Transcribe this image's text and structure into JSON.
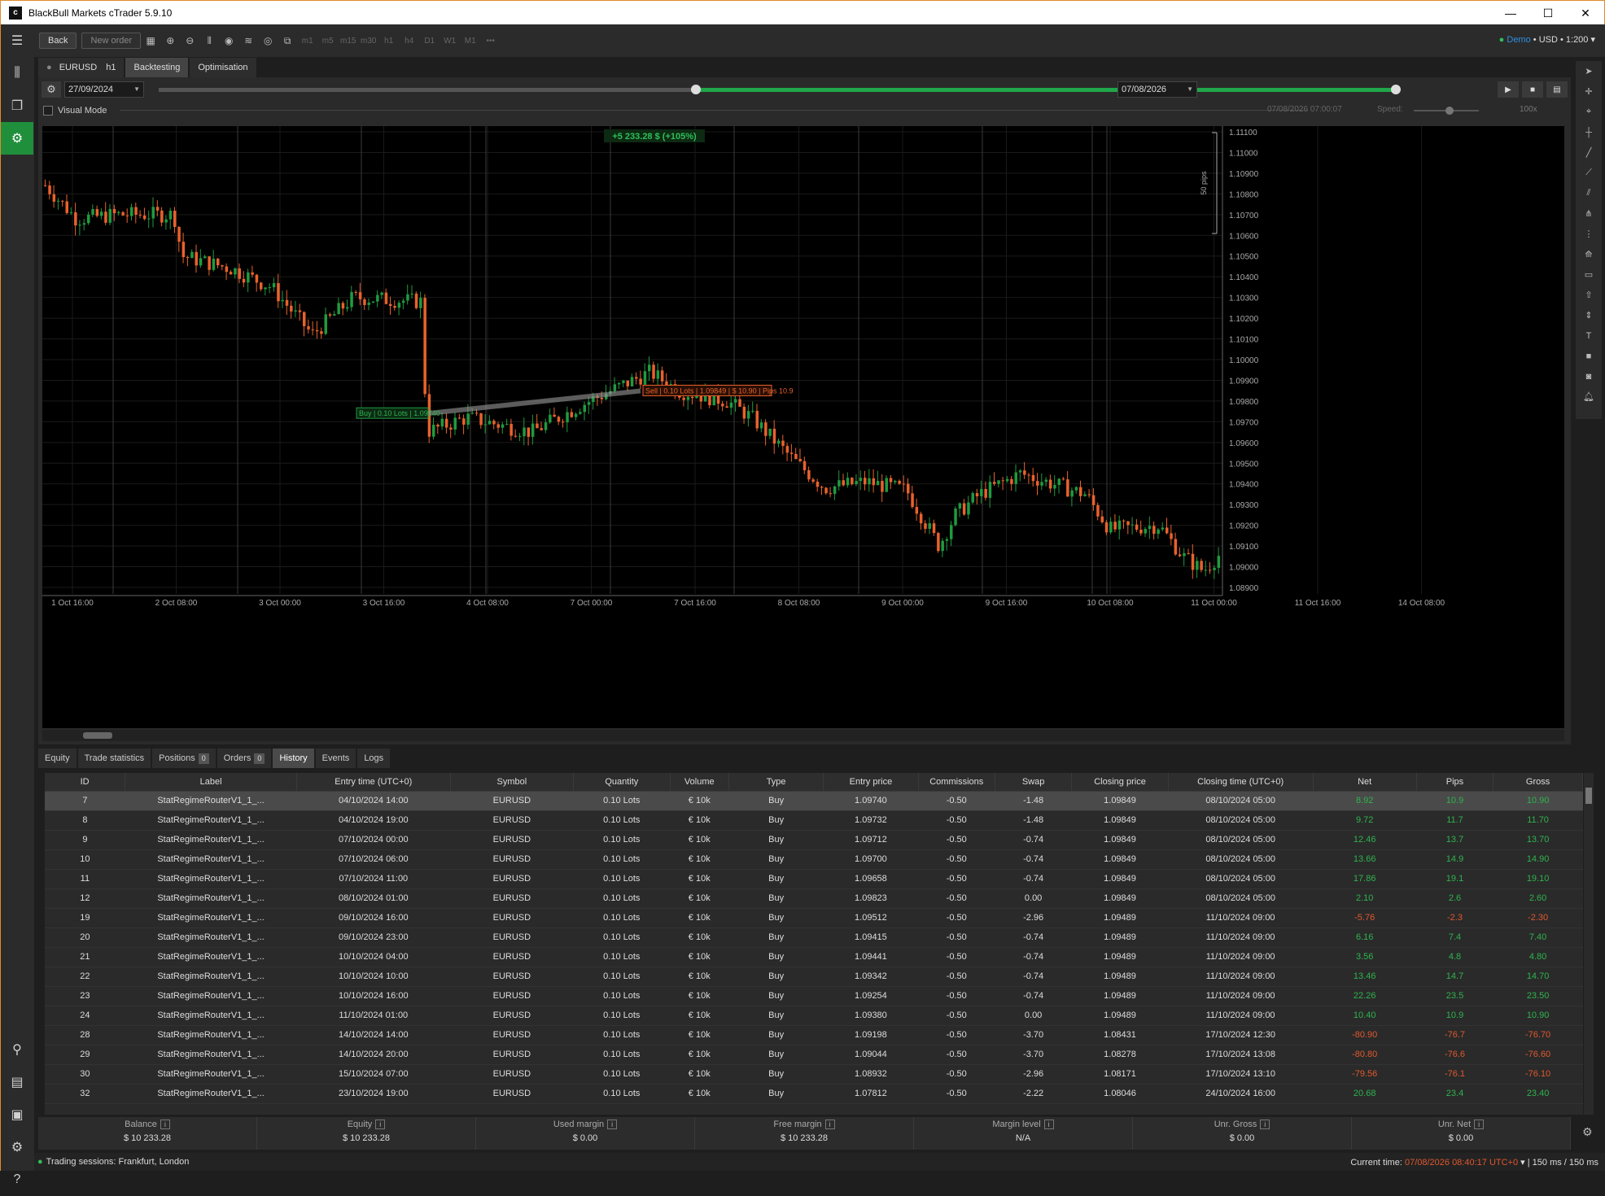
{
  "window": {
    "title": "BlackBull Markets cTrader 5.9.10",
    "min": "—",
    "max": "☐",
    "close": "✕"
  },
  "toolbar": {
    "back": "Back",
    "new_order": "New order",
    "timeframes": [
      "m1",
      "m5",
      "m15",
      "m30",
      "h1",
      "h4",
      "D1",
      "W1",
      "M1",
      "•••"
    ],
    "account": {
      "mode": "Demo",
      "currency": "USD",
      "leverage": "1:200"
    }
  },
  "tabs": {
    "symbol": "EURUSD",
    "timeframe": "h1",
    "backtesting": "Backtesting",
    "optimisation": "Optimisation"
  },
  "controls": {
    "start_date": "27/09/2024",
    "end_date": "07/08/2026",
    "visual_mode": "Visual Mode",
    "current_time": "07/08/2026 07:00:07",
    "speed_label": "Speed:",
    "speed_value": "100x"
  },
  "chart": {
    "profit_label": "+5 233.28 $ (+105%)",
    "scale_label": "50 pips",
    "price_ticks": [
      "1.11100",
      "1.11000",
      "1.10900",
      "1.10800",
      "1.10700",
      "1.10600",
      "1.10500",
      "1.10400",
      "1.10300",
      "1.10200",
      "1.10100",
      "1.10000",
      "1.09900",
      "1.09800",
      "1.09700",
      "1.09600",
      "1.09500",
      "1.09400",
      "1.09300",
      "1.09200",
      "1.09100",
      "1.09000",
      "1.08900"
    ],
    "time_ticks": [
      "1 Oct 16:00",
      "2 Oct 08:00",
      "3 Oct 00:00",
      "3 Oct 16:00",
      "4 Oct 08:00",
      "7 Oct 00:00",
      "7 Oct 16:00",
      "8 Oct 08:00",
      "9 Oct 00:00",
      "9 Oct 16:00",
      "10 Oct 08:00",
      "11 Oct 00:00",
      "11 Oct 16:00",
      "14 Oct 08:00"
    ],
    "buy_label": {
      "side": "Buy",
      "lots": "0.10 Lots",
      "price": "1.09740"
    },
    "sell_label": {
      "side": "Sell",
      "lots": "0.10 Lots",
      "price": "1.09849",
      "pnl": "$ 10.90",
      "pips": "Pips 10.9"
    },
    "colors": {
      "bull": "#1f9a3f",
      "bear": "#e8622c",
      "background": "#000000"
    }
  },
  "bottom_tabs": [
    {
      "label": "Equity"
    },
    {
      "label": "Trade statistics"
    },
    {
      "label": "Positions",
      "count": "0"
    },
    {
      "label": "Orders",
      "count": "0"
    },
    {
      "label": "History"
    },
    {
      "label": "Events"
    },
    {
      "label": "Logs"
    }
  ],
  "history": {
    "columns": [
      "ID",
      "Label",
      "Entry time (UTC+0)",
      "Symbol",
      "Quantity",
      "Volume",
      "Type",
      "Entry price",
      "Commissions",
      "Swap",
      "Closing price",
      "Closing time (UTC+0)",
      "Net",
      "Pips",
      "Gross"
    ],
    "rows": [
      [
        "7",
        "StatRegimeRouterV1_1_...",
        "04/10/2024 14:00",
        "EURUSD",
        "0.10 Lots",
        "€ 10k",
        "Buy",
        "1.09740",
        "-0.50",
        "-1.48",
        "1.09849",
        "08/10/2024 05:00",
        "8.92",
        "10.9",
        "10.90"
      ],
      [
        "8",
        "StatRegimeRouterV1_1_...",
        "04/10/2024 19:00",
        "EURUSD",
        "0.10 Lots",
        "€ 10k",
        "Buy",
        "1.09732",
        "-0.50",
        "-1.48",
        "1.09849",
        "08/10/2024 05:00",
        "9.72",
        "11.7",
        "11.70"
      ],
      [
        "9",
        "StatRegimeRouterV1_1_...",
        "07/10/2024 00:00",
        "EURUSD",
        "0.10 Lots",
        "€ 10k",
        "Buy",
        "1.09712",
        "-0.50",
        "-0.74",
        "1.09849",
        "08/10/2024 05:00",
        "12.46",
        "13.7",
        "13.70"
      ],
      [
        "10",
        "StatRegimeRouterV1_1_...",
        "07/10/2024 06:00",
        "EURUSD",
        "0.10 Lots",
        "€ 10k",
        "Buy",
        "1.09700",
        "-0.50",
        "-0.74",
        "1.09849",
        "08/10/2024 05:00",
        "13.66",
        "14.9",
        "14.90"
      ],
      [
        "11",
        "StatRegimeRouterV1_1_...",
        "07/10/2024 11:00",
        "EURUSD",
        "0.10 Lots",
        "€ 10k",
        "Buy",
        "1.09658",
        "-0.50",
        "-0.74",
        "1.09849",
        "08/10/2024 05:00",
        "17.86",
        "19.1",
        "19.10"
      ],
      [
        "12",
        "StatRegimeRouterV1_1_...",
        "08/10/2024 01:00",
        "EURUSD",
        "0.10 Lots",
        "€ 10k",
        "Buy",
        "1.09823",
        "-0.50",
        "0.00",
        "1.09849",
        "08/10/2024 05:00",
        "2.10",
        "2.6",
        "2.60"
      ],
      [
        "19",
        "StatRegimeRouterV1_1_...",
        "09/10/2024 16:00",
        "EURUSD",
        "0.10 Lots",
        "€ 10k",
        "Buy",
        "1.09512",
        "-0.50",
        "-2.96",
        "1.09489",
        "11/10/2024 09:00",
        "-5.76",
        "-2.3",
        "-2.30"
      ],
      [
        "20",
        "StatRegimeRouterV1_1_...",
        "09/10/2024 23:00",
        "EURUSD",
        "0.10 Lots",
        "€ 10k",
        "Buy",
        "1.09415",
        "-0.50",
        "-0.74",
        "1.09489",
        "11/10/2024 09:00",
        "6.16",
        "7.4",
        "7.40"
      ],
      [
        "21",
        "StatRegimeRouterV1_1_...",
        "10/10/2024 04:00",
        "EURUSD",
        "0.10 Lots",
        "€ 10k",
        "Buy",
        "1.09441",
        "-0.50",
        "-0.74",
        "1.09489",
        "11/10/2024 09:00",
        "3.56",
        "4.8",
        "4.80"
      ],
      [
        "22",
        "StatRegimeRouterV1_1_...",
        "10/10/2024 10:00",
        "EURUSD",
        "0.10 Lots",
        "€ 10k",
        "Buy",
        "1.09342",
        "-0.50",
        "-0.74",
        "1.09489",
        "11/10/2024 09:00",
        "13.46",
        "14.7",
        "14.70"
      ],
      [
        "23",
        "StatRegimeRouterV1_1_...",
        "10/10/2024 16:00",
        "EURUSD",
        "0.10 Lots",
        "€ 10k",
        "Buy",
        "1.09254",
        "-0.50",
        "-0.74",
        "1.09489",
        "11/10/2024 09:00",
        "22.26",
        "23.5",
        "23.50"
      ],
      [
        "24",
        "StatRegimeRouterV1_1_...",
        "11/10/2024 01:00",
        "EURUSD",
        "0.10 Lots",
        "€ 10k",
        "Buy",
        "1.09380",
        "-0.50",
        "0.00",
        "1.09489",
        "11/10/2024 09:00",
        "10.40",
        "10.9",
        "10.90"
      ],
      [
        "28",
        "StatRegimeRouterV1_1_...",
        "14/10/2024 14:00",
        "EURUSD",
        "0.10 Lots",
        "€ 10k",
        "Buy",
        "1.09198",
        "-0.50",
        "-3.70",
        "1.08431",
        "17/10/2024 12:30",
        "-80.90",
        "-76.7",
        "-76.70"
      ],
      [
        "29",
        "StatRegimeRouterV1_1_...",
        "14/10/2024 20:00",
        "EURUSD",
        "0.10 Lots",
        "€ 10k",
        "Buy",
        "1.09044",
        "-0.50",
        "-3.70",
        "1.08278",
        "17/10/2024 13:08",
        "-80.80",
        "-76.6",
        "-76.60"
      ],
      [
        "30",
        "StatRegimeRouterV1_1_...",
        "15/10/2024 07:00",
        "EURUSD",
        "0.10 Lots",
        "€ 10k",
        "Buy",
        "1.08932",
        "-0.50",
        "-2.96",
        "1.08171",
        "17/10/2024 13:10",
        "-79.56",
        "-76.1",
        "-76.10"
      ],
      [
        "32",
        "StatRegimeRouterV1_1_...",
        "23/10/2024 19:00",
        "EURUSD",
        "0.10 Lots",
        "€ 10k",
        "Buy",
        "1.07812",
        "-0.50",
        "-2.22",
        "1.08046",
        "24/10/2024 16:00",
        "20.68",
        "23.4",
        "23.40"
      ]
    ]
  },
  "footer": [
    {
      "label": "Balance",
      "value": "$ 10 233.28"
    },
    {
      "label": "Equity",
      "value": "$ 10 233.28"
    },
    {
      "label": "Used margin",
      "value": "$ 0.00"
    },
    {
      "label": "Free margin",
      "value": "$ 10 233.28"
    },
    {
      "label": "Margin level",
      "value": "N/A"
    },
    {
      "label": "Unr. Gross",
      "value": "$ 0.00"
    },
    {
      "label": "Unr. Net",
      "value": "$ 0.00"
    }
  ],
  "status": {
    "sessions": "Trading sessions: Frankfurt, London",
    "current_time_label": "Current time:",
    "current_time": "07/08/2026 08:40:17",
    "timezone": "UTC+0",
    "latency": "150 ms / 150 ms"
  }
}
